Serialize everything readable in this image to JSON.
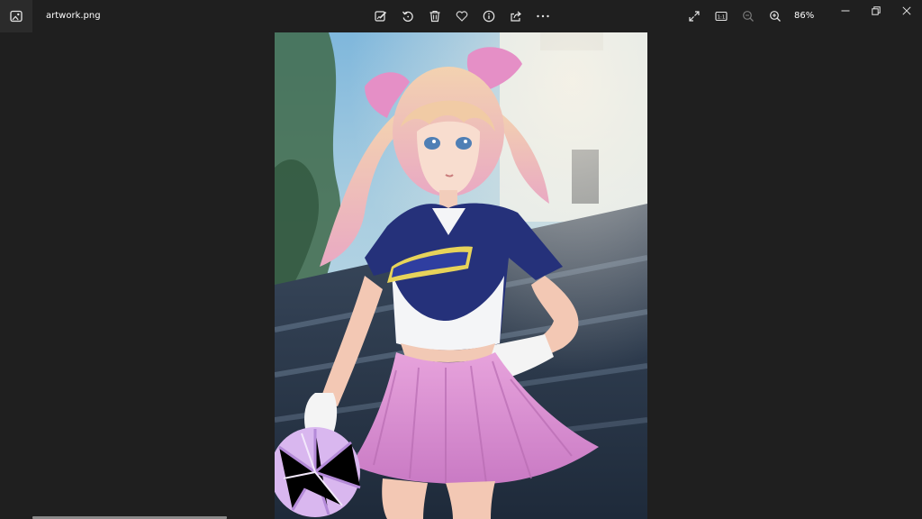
{
  "title_bar": {
    "app_icon": "photos-app-icon",
    "file_name": "artwork.png"
  },
  "toolbar": {
    "tools": [
      {
        "name": "edit-image-icon",
        "label": "Edit image"
      },
      {
        "name": "rotate-icon",
        "label": "Rotate"
      },
      {
        "name": "delete-icon",
        "label": "Delete"
      },
      {
        "name": "favorite-heart-icon",
        "label": "Add to favorites"
      },
      {
        "name": "info-icon",
        "label": "File information"
      },
      {
        "name": "share-icon",
        "label": "Share"
      },
      {
        "name": "more-icon",
        "label": "See more"
      }
    ],
    "view": [
      {
        "name": "fullscreen-icon",
        "label": "Full screen"
      },
      {
        "name": "actual-size-icon",
        "label": "Actual size"
      },
      {
        "name": "zoom-out-icon",
        "label": "Zoom out"
      },
      {
        "name": "zoom-in-icon",
        "label": "Zoom in"
      }
    ],
    "zoom_level": "86%"
  },
  "window_controls": [
    "minimize-icon",
    "restore-icon",
    "close-icon"
  ],
  "image": {
    "description_icon": "artwork-image",
    "horizontal_scroll_position": 0.0
  },
  "colors": {
    "background": "#1f1f1f",
    "text": "#ffffff",
    "icon": "#e6e6e6",
    "icon_disabled": "#7a7a7a"
  }
}
